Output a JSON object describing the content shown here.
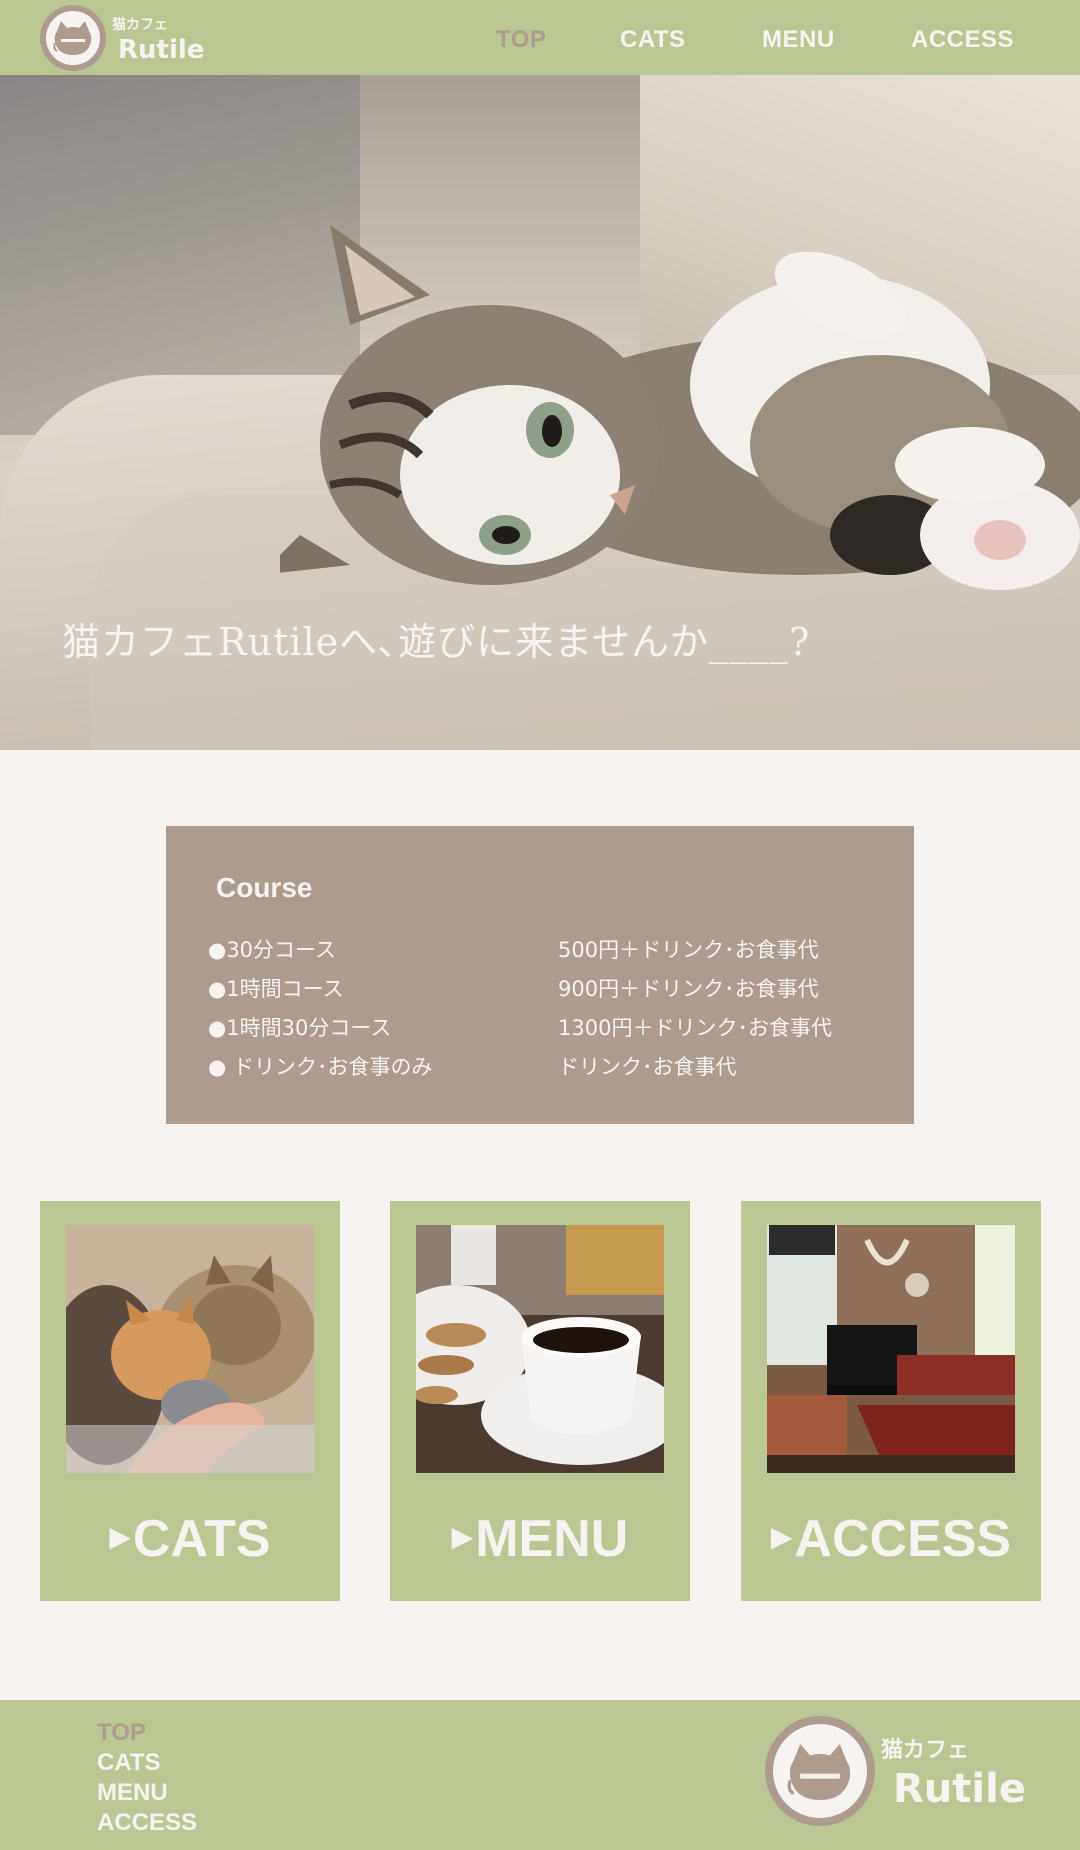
{
  "header": {
    "logo_small": "猫カフェ",
    "logo_big": "Rutile",
    "nav": [
      "TOP",
      "CATS",
      "MENU",
      "ACCESS"
    ],
    "active": "TOP"
  },
  "hero": {
    "tagline": "猫カフェRutileへ､遊びに来ませんか____?"
  },
  "course": {
    "title": "Course",
    "rows": [
      {
        "name": "●30分コース",
        "price": "500円＋ドリンク･お食事代"
      },
      {
        "name": "●1時間コース",
        "price": "900円＋ドリンク･お食事代"
      },
      {
        "name": "●1時間30分コース",
        "price": "1300円＋ドリンク･お食事代"
      },
      {
        "name": "● ドリンク･お食事のみ",
        "price": "ドリンク･お食事代"
      }
    ]
  },
  "cards": [
    {
      "icon": "play-triangle-icon",
      "label": "CATS"
    },
    {
      "icon": "play-triangle-icon",
      "label": "MENU"
    },
    {
      "icon": "play-triangle-icon",
      "label": "ACCESS"
    }
  ],
  "footer": {
    "nav": [
      "TOP",
      "CATS",
      "MENU",
      "ACCESS"
    ],
    "logo_small": "猫カフェ",
    "logo_big": "Rutile"
  },
  "colors": {
    "green": "#bac792",
    "taupe": "#ae9b90",
    "cream": "#f7f3f0"
  }
}
